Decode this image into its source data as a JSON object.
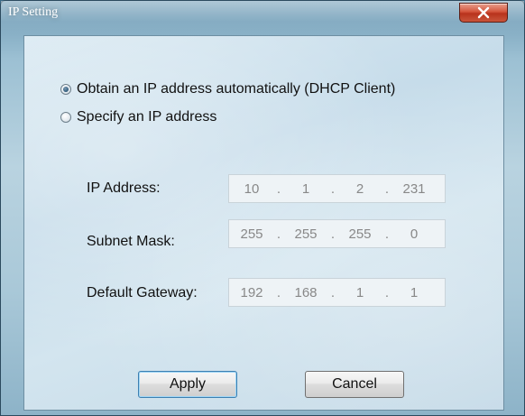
{
  "window": {
    "title": "IP Setting",
    "close_label": "X"
  },
  "mode": {
    "options": [
      {
        "label": "Obtain an IP address automatically (DHCP Client)",
        "selected": true
      },
      {
        "label": "Specify an IP address",
        "selected": false
      }
    ]
  },
  "fields": {
    "ip_address": {
      "label": "IP Address:",
      "octets": [
        "10",
        "1",
        "2",
        "231"
      ]
    },
    "subnet_mask": {
      "label": "Subnet Mask:",
      "octets": [
        "255",
        "255",
        "255",
        "0"
      ]
    },
    "default_gateway": {
      "label": "Default Gateway:",
      "octets": [
        "192",
        "168",
        "1",
        "1"
      ]
    },
    "separator": "."
  },
  "buttons": {
    "apply_label": "Apply",
    "cancel_label": "Cancel"
  },
  "colors": {
    "disabled_text": "#888888",
    "close_button": "#c9412a"
  },
  "icons": {
    "close": "close-icon"
  }
}
